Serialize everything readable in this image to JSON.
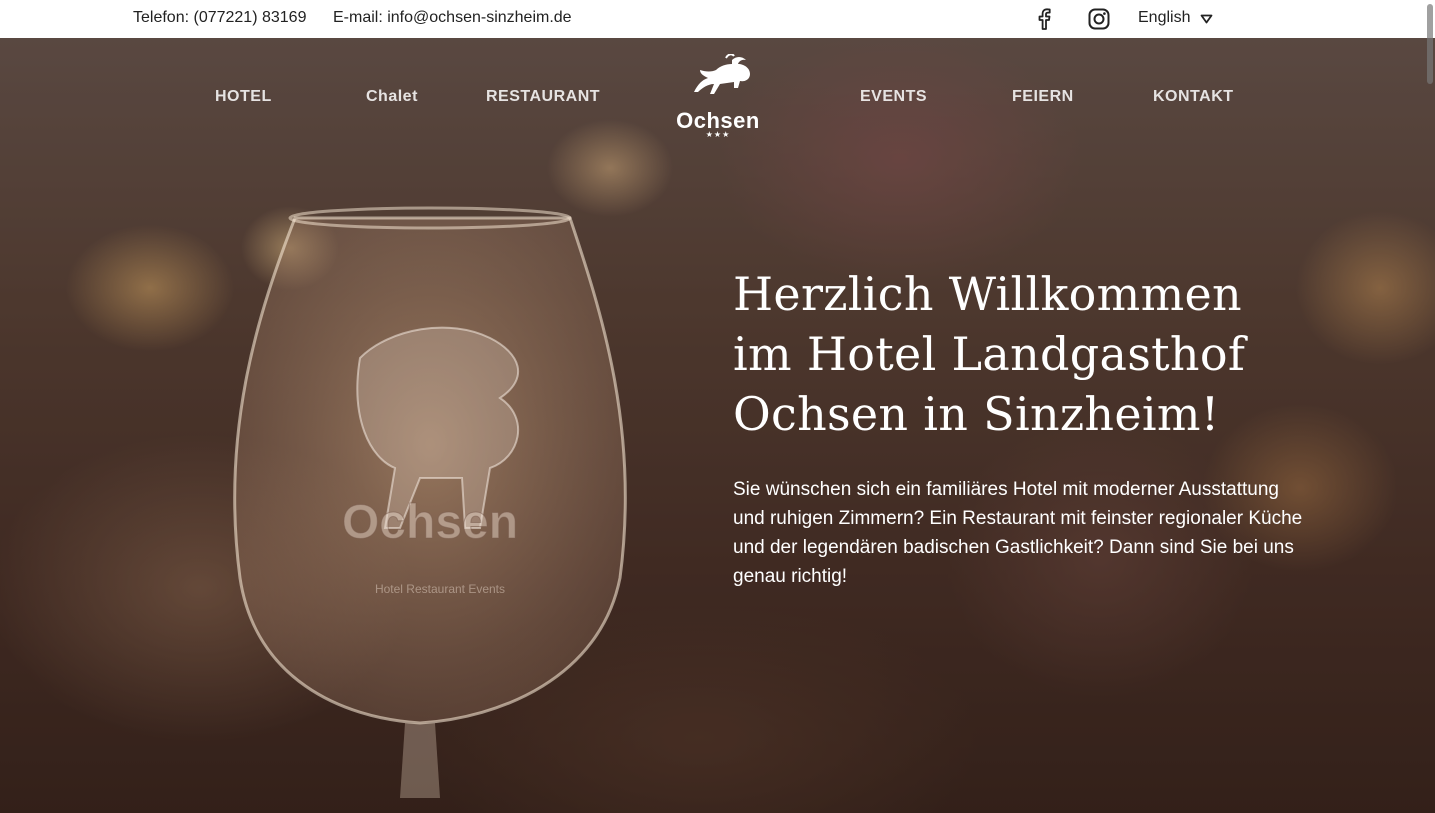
{
  "topbar": {
    "phone": "Telefon: (077221) 83169",
    "email": "E-mail: info@ochsen-sinzheim.de",
    "language": "English",
    "social": [
      "facebook-icon",
      "instagram-icon"
    ]
  },
  "nav": {
    "hotel": "HOTEL",
    "chalet": "Chalet",
    "restaurant": "RESTAURANT",
    "events": "EVENTS",
    "feiern": "FEIERN",
    "kontakt": "KONTAKT"
  },
  "logo": {
    "word": "Ochsen",
    "stars": "★★★"
  },
  "hero": {
    "headline_1": "Herzlich Willkommen",
    "headline_2": "im Hotel Landgasthof",
    "headline_3": "Ochsen in Sinzheim!",
    "intro": "Sie wünschen sich ein familiäres Hotel mit moderner Ausstattung und ruhigen Zimmern? Ein Restaurant mit feinster regionaler Küche und der legendären badischen Gastlichkeit? Dann sind Sie bei uns genau richtig!",
    "glass_text_1": "Ochsen",
    "glass_text_2": "Hotel Restaurant Events"
  },
  "colors": {
    "topbar_bg": "#ffffff",
    "text_dark": "#222222",
    "hero_text": "#ffffff"
  }
}
